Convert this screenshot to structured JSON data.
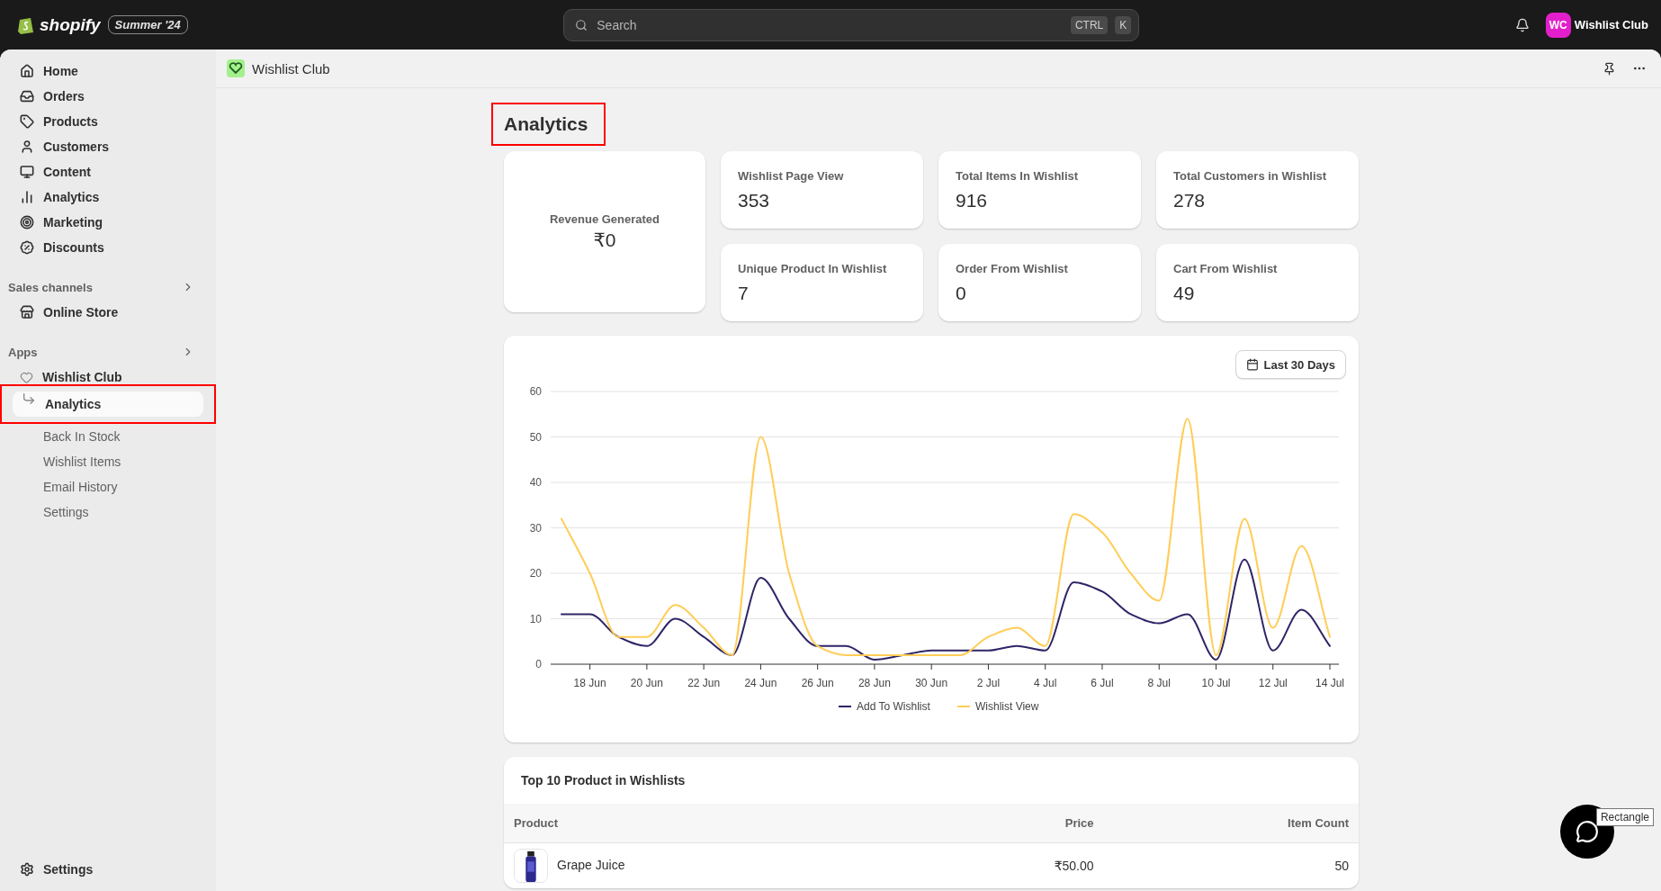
{
  "top_bar": {
    "brand": "shopify",
    "badge": "Summer '24",
    "search": {
      "placeholder": "Search",
      "shortcut": [
        "CTRL",
        "K"
      ]
    },
    "store": {
      "initials": "WC",
      "name": "Wishlist Club"
    }
  },
  "sidebar": {
    "items": [
      {
        "label": "Home",
        "selected": false
      },
      {
        "label": "Orders",
        "selected": false
      },
      {
        "label": "Products",
        "selected": false
      },
      {
        "label": "Customers",
        "selected": false
      },
      {
        "label": "Content",
        "selected": false
      },
      {
        "label": "Analytics",
        "selected": false
      },
      {
        "label": "Marketing",
        "selected": false
      },
      {
        "label": "Discounts",
        "selected": false
      }
    ],
    "sections": [
      {
        "title": "Sales channels",
        "items": [
          {
            "label": "Online Store",
            "selected": false
          }
        ]
      },
      {
        "title": "Apps",
        "items": [
          {
            "label": "Wishlist Club",
            "selected": false,
            "children": [
              {
                "label": "Analytics",
                "selected": true,
                "highlighted": true
              },
              {
                "label": "Back In Stock",
                "selected": false,
                "highlighted": false
              },
              {
                "label": "Wishlist Items",
                "selected": false,
                "highlighted": false
              },
              {
                "label": "Email History",
                "selected": false,
                "highlighted": false
              },
              {
                "label": "Settings",
                "selected": false,
                "highlighted": false
              }
            ]
          }
        ]
      }
    ],
    "footer": {
      "label": "Settings"
    }
  },
  "app_header": {
    "title": "Wishlist Club"
  },
  "page": {
    "title": "Analytics",
    "highlighted": true
  },
  "revenue": {
    "label": "Revenue Generated",
    "value": "₹0"
  },
  "stats": [
    {
      "label": "Wishlist Page View",
      "value": "353"
    },
    {
      "label": "Total Items In Wishlist",
      "value": "916"
    },
    {
      "label": "Total Customers in Wishlist",
      "value": "278"
    },
    {
      "label": "Unique Product In Wishlist",
      "value": "7"
    },
    {
      "label": "Order From Wishlist",
      "value": "0"
    },
    {
      "label": "Cart From Wishlist",
      "value": "49"
    }
  ],
  "chart": {
    "range_button": "Last 30 Days",
    "chart_data": {
      "type": "line",
      "grid": true,
      "legend": true,
      "x": [
        null,
        "18 Jun",
        null,
        "20 Jun",
        null,
        "22 Jun",
        null,
        "24 Jun",
        null,
        "26 Jun",
        null,
        "28 Jun",
        null,
        "30 Jun",
        null,
        "2 Jul",
        null,
        "4 Jul",
        null,
        "6 Jul",
        null,
        "8 Jul",
        null,
        "10 Jul",
        null,
        "12 Jul",
        null,
        "14 Jul"
      ],
      "ylim": [
        0,
        60
      ],
      "yticks": [
        0,
        10,
        20,
        30,
        40,
        50,
        60
      ],
      "series": [
        {
          "name": "Add To Wishlist",
          "color": "#2e2566",
          "values": [
            11,
            11,
            6,
            4,
            10,
            6,
            2,
            19,
            10,
            4,
            4,
            1,
            2,
            3,
            3,
            3,
            4,
            3,
            18,
            16,
            11,
            9,
            11,
            1,
            23,
            3,
            12,
            4
          ]
        },
        {
          "name": "Wishlist View",
          "color": "#ffcd57",
          "values": [
            32,
            20,
            6,
            6,
            13,
            8,
            2,
            50,
            20,
            4,
            2,
            2,
            2,
            2,
            2,
            6,
            8,
            4,
            33,
            29,
            20,
            14,
            54,
            2,
            32,
            8,
            26,
            6
          ]
        }
      ]
    }
  },
  "table": {
    "title": "Top 10 Product in Wishlists",
    "columns": [
      "Product",
      "Price",
      "Item Count"
    ],
    "rows": [
      {
        "product": "Grape Juice",
        "price": "₹50.00",
        "count": "50",
        "kind": "picture"
      }
    ]
  },
  "tooltip": "Rectangle"
}
